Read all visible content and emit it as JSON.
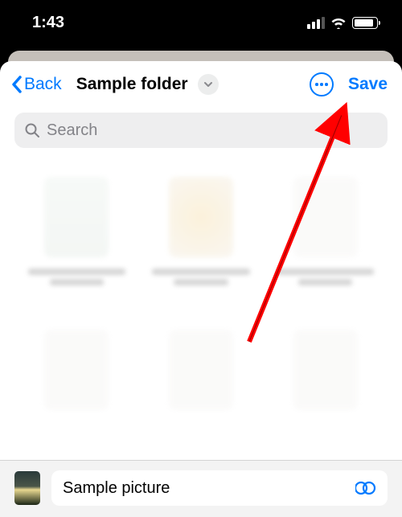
{
  "status": {
    "time": "1:43"
  },
  "nav": {
    "back_label": "Back",
    "title": "Sample folder",
    "save_label": "Save"
  },
  "search": {
    "placeholder": "Search",
    "value": ""
  },
  "attachment": {
    "filename": "Sample picture"
  }
}
